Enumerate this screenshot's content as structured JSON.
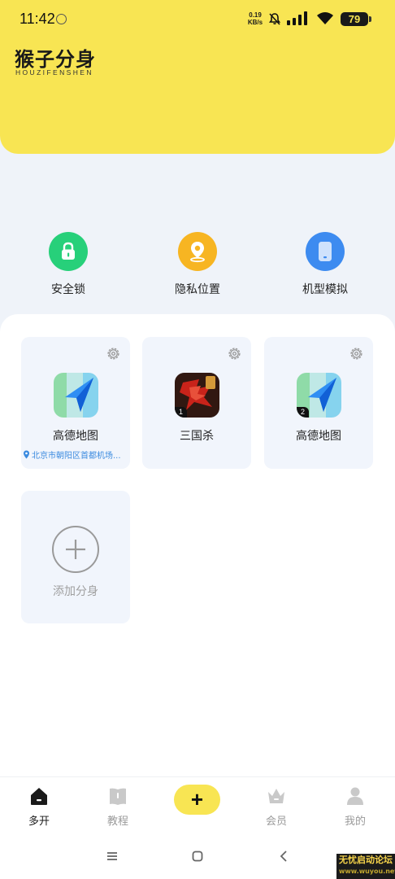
{
  "status_bar": {
    "time": "11:42",
    "net_speed_value": "0.19",
    "net_speed_unit": "KB/s",
    "battery": "79"
  },
  "header": {
    "logo_cn": "猴子分身",
    "logo_en": "HOUZIFENSHEN",
    "background_color": "#f8e553"
  },
  "features": [
    {
      "label": "安全锁",
      "icon": "lock-icon",
      "color": "#27d07a"
    },
    {
      "label": "隐私位置",
      "icon": "location-pin-icon",
      "color": "#f7b522"
    },
    {
      "label": "机型模拟",
      "icon": "phone-icon",
      "color": "#3d8bf0"
    }
  ],
  "apps": [
    {
      "name": "高德地图",
      "badge": "",
      "location": "北京市朝阳区首都机场...",
      "icon": "amap-icon"
    },
    {
      "name": "三国杀",
      "badge": "1",
      "location": "",
      "icon": "sanguosha-icon"
    },
    {
      "name": "高德地图",
      "badge": "2",
      "location": "",
      "icon": "amap-icon"
    }
  ],
  "add_clone": {
    "label": "添加分身"
  },
  "bottom_nav": [
    {
      "label": "多开",
      "icon": "home-icon",
      "active": true
    },
    {
      "label": "教程",
      "icon": "book-icon",
      "active": false
    },
    {
      "label": "+",
      "icon": "plus-icon",
      "active": false
    },
    {
      "label": "会员",
      "icon": "crown-icon",
      "active": false
    },
    {
      "label": "我的",
      "icon": "person-icon",
      "active": false
    }
  ],
  "watermark": {
    "line1": "无忧启动论坛",
    "line2": "www.wuyou.net"
  }
}
